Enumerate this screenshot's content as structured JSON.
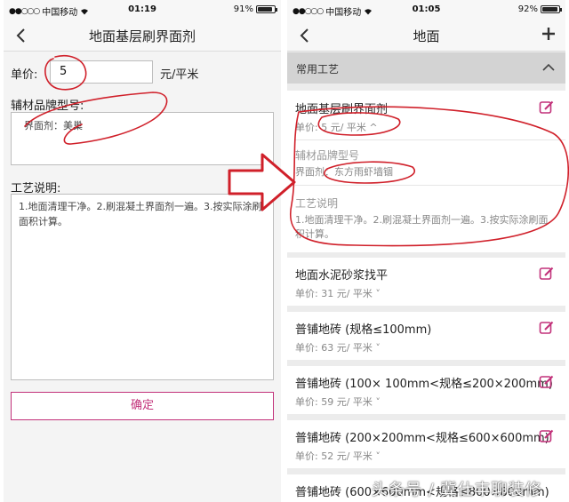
{
  "left": {
    "status": {
      "carrier": "中国移动",
      "time": "01:19",
      "battery": "91%",
      "battery_level": 0.91
    },
    "nav": {
      "title": "地面基层刷界面剂"
    },
    "form": {
      "price_label": "单价:",
      "price_value": "5",
      "price_unit": "元/平米",
      "brand_label": "辅材品牌型号:",
      "brand_value": "界面剂：美巢",
      "desc_label": "工艺说明:",
      "desc_value": "1.地面清理干净。2.刷混凝土界面剂一遍。3.按实际涂刷面积计算。",
      "confirm_label": "确定"
    }
  },
  "right": {
    "status": {
      "carrier": "中国移动",
      "time": "01:05",
      "battery": "92%",
      "battery_level": 0.92
    },
    "nav": {
      "title": "地面"
    },
    "section": {
      "title": "常用工艺"
    },
    "items": [
      {
        "title": "地面基层刷界面剂",
        "price": "单价:  5 元/ 平米 ^",
        "brand_label": "辅材品牌型号",
        "brand_value": "界面剂：东方雨虾墙锢",
        "desc_label": "工艺说明",
        "desc_value": "1.地面清理干净。2.刷混凝土界面剂一遍。3.按实际涂刷面积计算。"
      },
      {
        "title": "地面水泥砂浆找平",
        "price": "单价:  31 元/ 平米 ˅"
      },
      {
        "title": "普铺地砖 (规格≤100mm)",
        "price": "单价:  63 元/ 平米 ˅"
      },
      {
        "title": "普铺地砖 (100× 100mm<规格≤200×200mm)",
        "price": "单价:  59 元/ 平米 ˅"
      },
      {
        "title": "普铺地砖 (200×200mm<规格≤600×600mm)",
        "price": "单价:  52 元/ 平米 ˅"
      },
      {
        "title": "普铺地砖 (600×600mm<规格≤800×800mm)"
      }
    ]
  },
  "watermark": "头条号 / 冀仕丰聊装修",
  "colors": {
    "accent": "#c2317a",
    "annotation": "#d0202a",
    "section_bg": "#d3d3d3"
  }
}
